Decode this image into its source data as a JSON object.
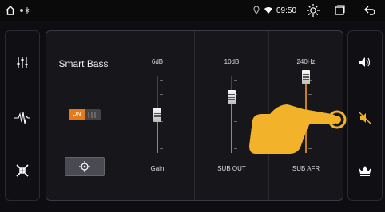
{
  "status": {
    "time": "09:50"
  },
  "panel": {
    "title": "Smart Bass",
    "toggle_label": "ON",
    "sliders": [
      {
        "value": "6dB",
        "label": "Gain",
        "level": 0.5
      },
      {
        "value": "10dB",
        "label": "SUB OUT",
        "level": 0.72
      },
      {
        "value": "240Hz",
        "label": "SUB AFR",
        "level": 0.98
      }
    ]
  },
  "left_icons": [
    "equalizer-icon",
    "waveform-icon",
    "balance-arrows-icon"
  ],
  "right_icons": [
    "speaker-icon",
    "bass-boost-icon",
    "crown-icon"
  ],
  "colors": {
    "accent": "#e57a1a",
    "hand": "#f2b22a"
  }
}
